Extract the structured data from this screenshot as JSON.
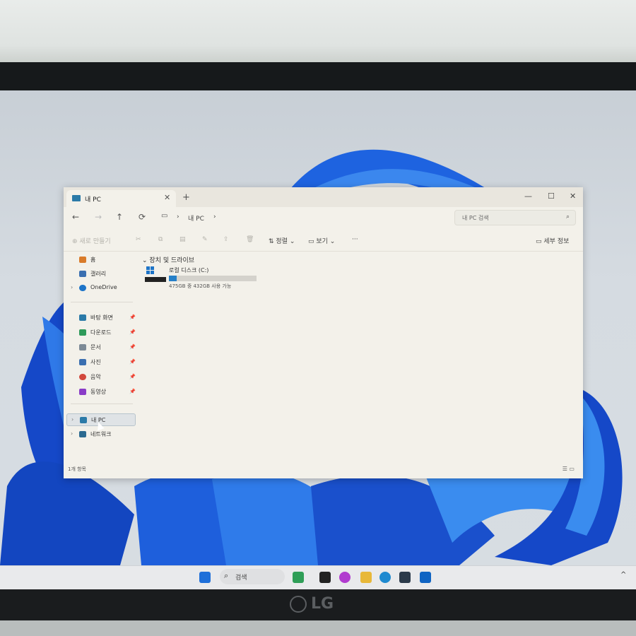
{
  "window": {
    "tab_title": "내 PC",
    "new_tab": "+",
    "controls": {
      "minimize": "—",
      "maximize": "☐",
      "close": "✕"
    },
    "breadcrumb": [
      "내 PC"
    ],
    "search_placeholder": "내 PC 검색"
  },
  "toolbar": {
    "new_label": "새로 만들기",
    "sort_label": "정렬",
    "view_label": "보기",
    "more_label": "···",
    "details_label": "세부 정보"
  },
  "sidebar": {
    "top": [
      {
        "label": "홈",
        "icon": "home-icon"
      },
      {
        "label": "갤러리",
        "icon": "gallery-icon"
      },
      {
        "label": "OneDrive",
        "icon": "cloud-icon"
      }
    ],
    "quick": [
      {
        "label": "바탕 화면",
        "icon": "desktop-icon"
      },
      {
        "label": "다운로드",
        "icon": "download-icon"
      },
      {
        "label": "문서",
        "icon": "document-icon"
      },
      {
        "label": "사진",
        "icon": "pictures-icon"
      },
      {
        "label": "음악",
        "icon": "music-icon"
      },
      {
        "label": "동영상",
        "icon": "video-icon"
      }
    ],
    "bottom": [
      {
        "label": "내 PC",
        "icon": "pc-icon"
      },
      {
        "label": "네트워크",
        "icon": "network-icon"
      }
    ]
  },
  "main": {
    "section_title": "장치 및 드라이브",
    "drive": {
      "name": "로컬 디스크 (C:)",
      "free_text": "475GB 중 432GB 사용 가능",
      "used_fraction": 0.09
    }
  },
  "status": {
    "items": "1개 항목"
  },
  "taskbar": {
    "search_label": "검색"
  },
  "colors": {
    "accent": "#1d74c8",
    "bloom": "#1553d6"
  }
}
